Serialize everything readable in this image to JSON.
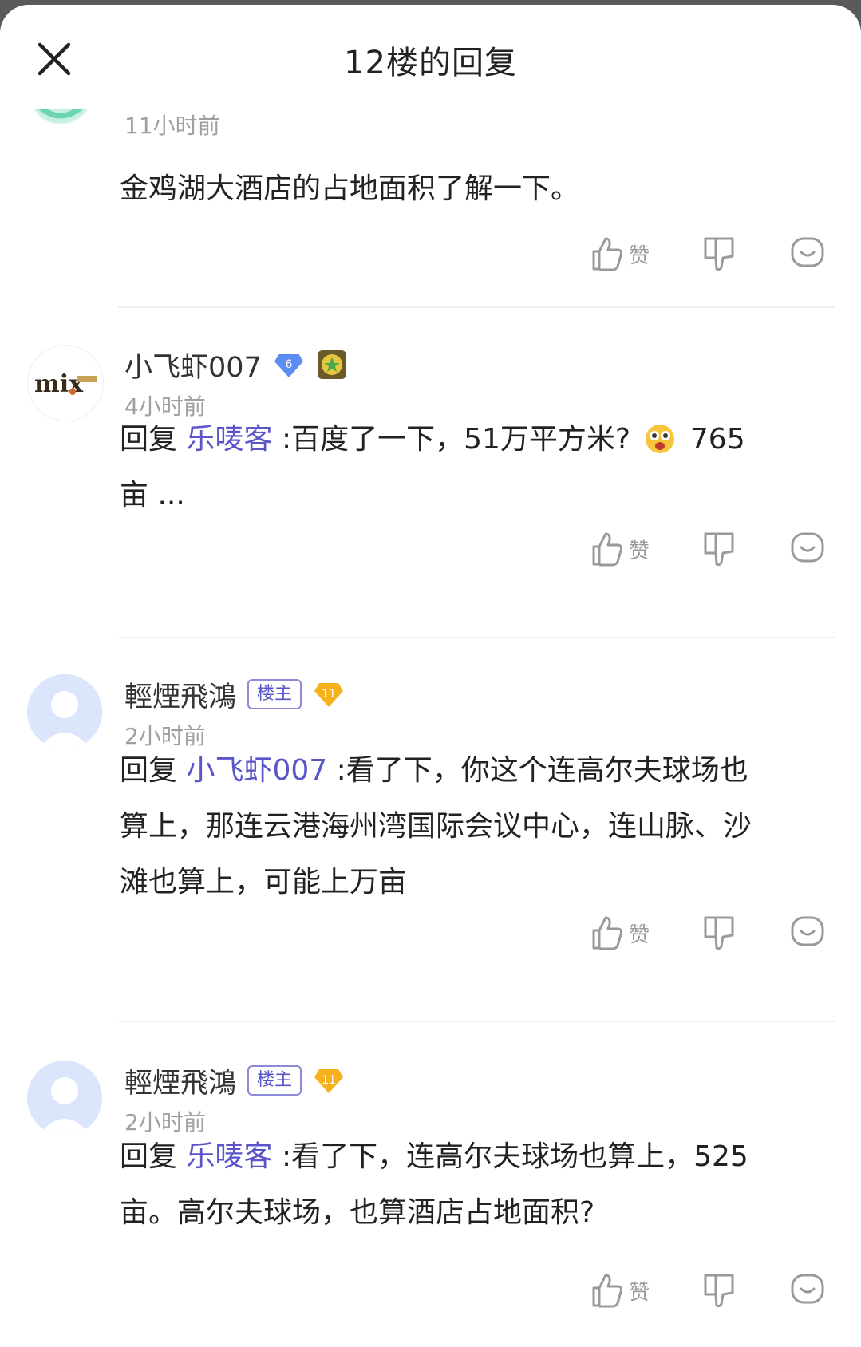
{
  "header": {
    "title": "12楼的回复"
  },
  "colors": {
    "mention": "#5a55c8",
    "owner_tag": "#5656c8",
    "level_badge": "#f6b21c",
    "vip_badge": "#5b8ef0"
  },
  "replies": [
    {
      "username": "",
      "time": "11小时前",
      "text": "金鸡湖大酒店的占地面积了解一下。",
      "like_label": "赞",
      "avatar_icon": "green-smiley-avatar"
    },
    {
      "username": "小飞虾007",
      "vip_level": "6",
      "time": "4小时前",
      "reply_prefix": "回复",
      "mention": "乐唛客",
      "text_line1": ":百度了一下，51万平方米?",
      "text_after_emoji": "765",
      "text_line2": "亩 ...",
      "avatar_logo": "mix",
      "like_label": "赞"
    },
    {
      "username": "輕煙飛鴻",
      "owner_tag": "楼主",
      "level": "11",
      "time": "2小时前",
      "reply_prefix": "回复",
      "mention": "小飞虾007",
      "text_line1": ":看了下，你这个连高尔夫球场也",
      "text_line2": "算上，那连云港海州湾国际会议中心，连山脉、沙",
      "text_line3": "滩也算上，可能上万亩",
      "like_label": "赞"
    },
    {
      "username": "輕煙飛鴻",
      "owner_tag": "楼主",
      "level": "11",
      "time": "2小时前",
      "reply_prefix": "回复",
      "mention": "乐唛客",
      "text_line1": ":看了下，连高尔夫球场也算上，525",
      "text_line2": "亩。高尔夫球场，也算酒店占地面积?",
      "like_label": "赞"
    }
  ]
}
